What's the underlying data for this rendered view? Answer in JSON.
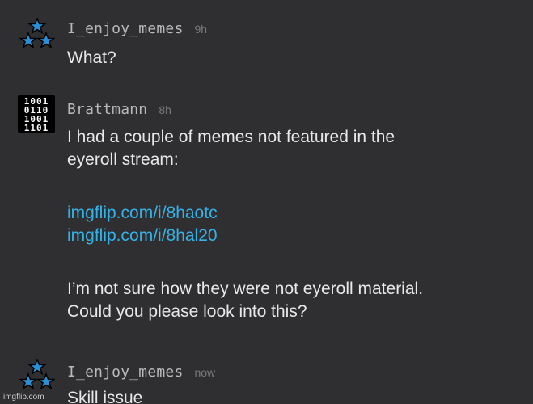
{
  "comments": [
    {
      "username": "I_enjoy_memes",
      "time": "9h",
      "avatar": "stars-icon",
      "text": "What?"
    },
    {
      "username": "Brattmann",
      "time": "8h",
      "avatar": "binary-icon",
      "avatar_rows": [
        "1001",
        "0110",
        "1001",
        "1101"
      ],
      "lines": [
        "I had a couple of memes not featured in the",
        "eyeroll stream:"
      ],
      "links": [
        "imgflip.com/i/8haotc",
        "imgflip.com/i/8hal20"
      ],
      "lines2": [
        "I’m not sure how they were not eyeroll material.",
        "Could you please look into this?"
      ]
    },
    {
      "username": "I_enjoy_memes",
      "time": "now",
      "avatar": "stars-icon",
      "text": "Skill issue"
    }
  ],
  "watermark": "imgflip.com",
  "colors": {
    "background": "#2f2f31",
    "username": "#b9b9b9",
    "timestamp": "#7a7a7a",
    "text": "#e8e8e8",
    "link": "#35b3e8",
    "star": "#2b8fd6"
  }
}
